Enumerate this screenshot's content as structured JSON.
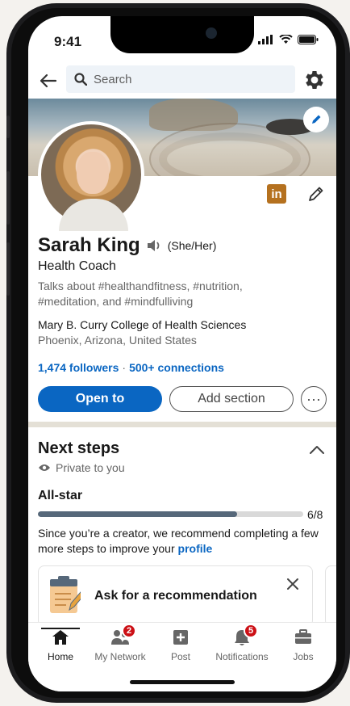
{
  "status_bar": {
    "time": "9:41"
  },
  "search": {
    "placeholder": "Search"
  },
  "profile": {
    "name": "Sarah King",
    "pronouns": "(She/Her)",
    "headline": "Health Coach",
    "about": "Talks about #healthandfitness, #nutrition, #meditation, and #mindfulliving",
    "school": "Mary B. Curry College of Health Sciences",
    "location": "Phoenix, Arizona, United States",
    "followers": "1,474 followers",
    "connections": "500+ connections",
    "linkedin_badge": "in"
  },
  "actions": {
    "open_to": "Open to",
    "add_section": "Add section",
    "more": "···"
  },
  "next_steps": {
    "title": "Next steps",
    "visibility": "Private to you",
    "level": "All-star",
    "progress_fraction": 0.75,
    "progress_label": "6/8",
    "message_prefix": "Since you’re a creator, we recommend completing a few more steps to improve your",
    "message_link": "profile",
    "card_title": "Ask for a recommendation"
  },
  "nav": {
    "tabs": [
      {
        "label": "Home",
        "badge": ""
      },
      {
        "label": "My Network",
        "badge": "2"
      },
      {
        "label": "Post",
        "badge": ""
      },
      {
        "label": "Notifications",
        "badge": "5"
      },
      {
        "label": "Jobs",
        "badge": ""
      }
    ]
  },
  "colors": {
    "accent": "#0a66c2",
    "badge": "#cc1016",
    "progress": "#56687a"
  }
}
